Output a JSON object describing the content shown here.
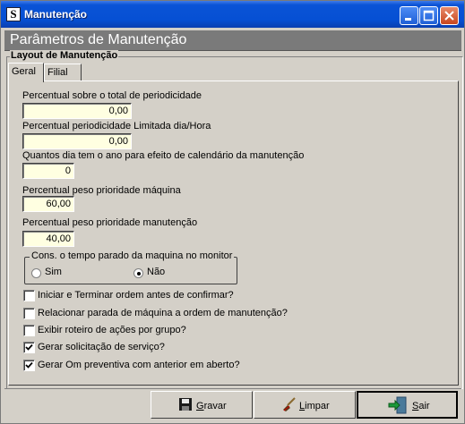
{
  "window": {
    "title": "Manutenção",
    "app_icon_letter": "S"
  },
  "header": {
    "title": "Parâmetros de Manutenção"
  },
  "group": {
    "title": "Layout de Manutenção"
  },
  "tabs": [
    {
      "label": "Geral",
      "active": true
    },
    {
      "label": "Filial",
      "active": false
    }
  ],
  "fields": {
    "percentual_total": {
      "label": "Percentual sobre o total de periodicidade",
      "value": "0,00"
    },
    "percentual_limitada": {
      "label": "Percentual periodicidade Limitada dia/Hora",
      "value": "0,00"
    },
    "dias_ano": {
      "label": "Quantos dia tem o ano para efeito de calendário da manutenção",
      "value": "0"
    },
    "peso_maquina": {
      "label": "Percentual peso prioridade máquina",
      "value": "60,00"
    },
    "peso_manutencao": {
      "label": "Percentual peso prioridade manutenção",
      "value": "40,00"
    }
  },
  "radio_group": {
    "title": "Cons. o tempo parado da maquina no monitor",
    "options": [
      {
        "label": "Sim",
        "selected": false
      },
      {
        "label": "Não",
        "selected": true
      }
    ]
  },
  "checkboxes": [
    {
      "label": "Iniciar e Terminar ordem antes de confirmar?",
      "checked": false
    },
    {
      "label": "Relacionar parada de máquina a ordem de manutenção?",
      "checked": false
    },
    {
      "label": "Exibir roteiro de ações por grupo?",
      "checked": false
    },
    {
      "label": "Gerar solicitação de serviço?",
      "checked": true
    },
    {
      "label": "Gerar Om preventiva com anterior em aberto?",
      "checked": true
    }
  ],
  "buttons": {
    "gravar": {
      "first": "G",
      "rest": "ravar"
    },
    "limpar": {
      "first": "L",
      "rest": "impar"
    },
    "sair": {
      "first": "S",
      "rest": "air"
    }
  },
  "colors": {
    "titlebar": "#0a53d6",
    "field_bg": "#ffffe1",
    "header_bg": "#7a7a7a"
  }
}
